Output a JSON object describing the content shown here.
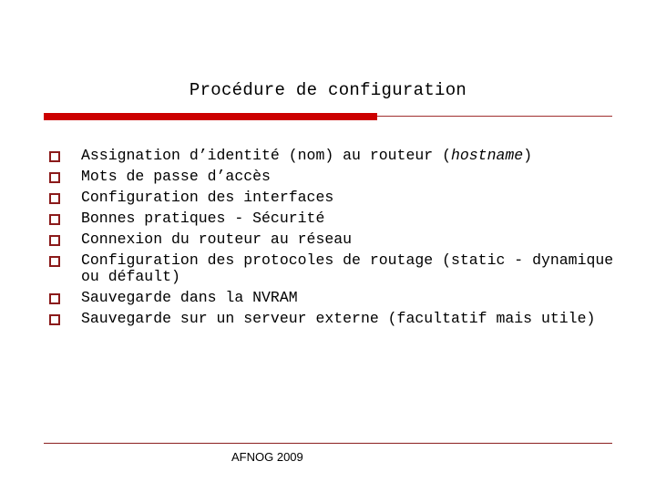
{
  "slide": {
    "title": "Procédure de configuration",
    "bullets": [
      {
        "text": "Assignation d’identité (nom) au routeur (",
        "italic": "hostname",
        "suffix": ")"
      },
      {
        "text": "Mots de passe d’accès"
      },
      {
        "text": "Configuration des interfaces"
      },
      {
        "text": "Bonnes pratiques - Sécurité"
      },
      {
        "text": "Connexion du routeur au réseau"
      },
      {
        "text": "Configuration des protocoles de routage (static - dynamique ou défault)"
      },
      {
        "text": "Sauvegarde dans la NVRAM"
      },
      {
        "text": "Sauvegarde sur un serveur externe (facultatif mais utile)"
      }
    ],
    "bullet_icon": "hollow-square-icon",
    "footer": "AFNOG 2009",
    "colors": {
      "accent": "#cc0000",
      "bullet": "#8b1a1a",
      "rule": "#a03030"
    }
  }
}
